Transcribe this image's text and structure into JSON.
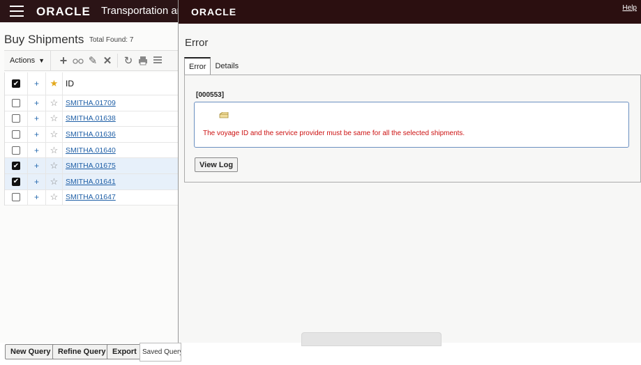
{
  "app": {
    "logo": "ORACLE",
    "title": "Transportation and"
  },
  "page": {
    "title": "Buy Shipments",
    "total_found": "Total Found: 7"
  },
  "toolbar": {
    "actions_label": "Actions",
    "icons": [
      "add-icon",
      "view-icon",
      "edit-icon",
      "delete-icon",
      "refresh-icon",
      "print-icon",
      "list-icon"
    ]
  },
  "grid": {
    "header_id": "ID",
    "rows": [
      {
        "id": "SMITHA.01709",
        "checked": false
      },
      {
        "id": "SMITHA.01638",
        "checked": false
      },
      {
        "id": "SMITHA.01636",
        "checked": false
      },
      {
        "id": "SMITHA.01640",
        "checked": false
      },
      {
        "id": "SMITHA.01675",
        "checked": true
      },
      {
        "id": "SMITHA.01641",
        "checked": true
      },
      {
        "id": "SMITHA.01647",
        "checked": false
      }
    ]
  },
  "bottom": {
    "new_query": "New Query",
    "refine_query": "Refine Query",
    "export": "Export",
    "saved_query": "Saved Query"
  },
  "dialog": {
    "logo": "ORACLE",
    "help": "Help",
    "title": "Error",
    "tabs": [
      "Error",
      "Details"
    ],
    "error_code": "[000553]",
    "message": "The voyage ID and the service provider must be same for all the selected shipments.",
    "view_log": "View Log"
  },
  "colors": {
    "header_bg": "#2b1416",
    "link": "#1f5fa6",
    "error_text": "#cc1111",
    "selected_row": "#e7f0fa"
  }
}
